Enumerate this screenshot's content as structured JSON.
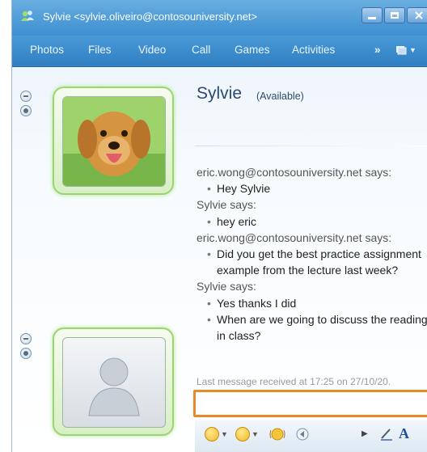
{
  "window": {
    "title": "Sylvie <sylvie.oliveiro@contosouniversity.net>",
    "controls": [
      "minimize",
      "maximize",
      "close"
    ]
  },
  "menu": {
    "items": [
      "Photos",
      "Files",
      "Video",
      "Call",
      "Games",
      "Activities"
    ],
    "more": "»"
  },
  "contact": {
    "name": "Sylvie",
    "status": "(Available)"
  },
  "conversation": {
    "entries": [
      {
        "sender": "eric.wong@contosouniversity.net says:",
        "messages": [
          "Hey Sylvie"
        ]
      },
      {
        "sender": "Sylvie says:",
        "messages": [
          "hey eric"
        ]
      },
      {
        "sender": "eric.wong@contosouniversity.net says:",
        "messages": [
          "Did you get the best practice assignment example from the lecture last week?"
        ]
      },
      {
        "sender": "Sylvie says:",
        "messages": [
          "Yes thanks I did",
          "When are we going to discuss the reading in class?"
        ]
      }
    ],
    "last_message": "Last message received at 17:25 on 27/10/20."
  },
  "input": {
    "value": "",
    "placeholder": ""
  },
  "toolbar": {
    "items": [
      "emoticons",
      "winks",
      "nudge",
      "voice-clip",
      "more",
      "handwriting",
      "font"
    ],
    "font_label": "A"
  },
  "colors": {
    "titlebar": "#3d8fd1",
    "menubar": "#2f7fc2",
    "input_border": "#e98a2a",
    "avatar_glow": "#9ad56f",
    "name_text": "#2b4a6f"
  }
}
